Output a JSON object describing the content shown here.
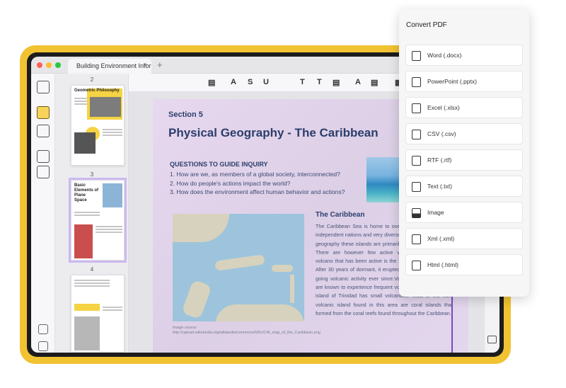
{
  "window": {
    "tab_title": "Building Environment Infor",
    "tab_close": "×",
    "tab_add": "+"
  },
  "thumbnails": [
    {
      "page": "2",
      "title": "Geometric Philosophy"
    },
    {
      "page": "3",
      "title": "Basic Elements of Plane Space"
    },
    {
      "page": "4",
      "title": ""
    }
  ],
  "toolbar": {
    "tools": [
      "▤",
      "A",
      "S",
      "U",
      "T",
      "T",
      "▤",
      "▤",
      "A",
      "▤",
      "▦",
      "◍"
    ],
    "tool_icons": [
      "comment-icon",
      "highlight-icon",
      "strikethrough-icon",
      "underline-icon",
      "text-icon",
      "textbox-icon",
      "note-icon",
      "list-icon",
      "pen-icon",
      "eraser-icon",
      "shape-icon",
      "stamp-icon"
    ]
  },
  "document": {
    "section_label": "Section 5",
    "title": "Physical Geography - The Caribbean",
    "questions_heading": "QUESTIONS TO GUIDE INQUIRY",
    "questions": [
      "1. How are we, as members of a global society, interconnected?",
      "2. How do people's actions impact the world?",
      "3. How does the environment affect human behavior and actions?"
    ],
    "map_caption": "Image source: http://upload.wikimedia.org/wikipedia/commons/0/0c/CIA_map_of_the_Caribbean.png",
    "caribbean_title": "The Caribbean",
    "caribbean_body": "The Caribbean Sea is home to over thirteen of which are independent nations and very diverse in terms of its physical geography these islands are primarily the result of volcanic. There are however few active volcanoes, one known volcano that has been active is the Soufriere of Montserrat. After 30 years of dormant, it erupted in 1995 and has been going volcanic activity ever since.Various of the Caribbean are known to experience frequent volcanic activity, even the island of Trinidad has small volcanoes. Most of the non-volcanic island found in this area are coral islands that formed from the coral reefs found throughout the Caribbean."
  },
  "convert_panel": {
    "title": "Convert PDF",
    "items": [
      {
        "label": "Word (.docx)",
        "icon": "word-icon"
      },
      {
        "label": "PowerPoint (.pptx)",
        "icon": "powerpoint-icon"
      },
      {
        "label": "Excel (.xlsx)",
        "icon": "excel-icon"
      },
      {
        "label": "CSV (.csv)",
        "icon": "csv-icon"
      },
      {
        "label": "RTF (.rtf)",
        "icon": "rtf-icon"
      },
      {
        "label": "Text (.txt)",
        "icon": "text-file-icon"
      },
      {
        "label": "Image",
        "icon": "image-icon"
      },
      {
        "label": "Xml (.xml)",
        "icon": "xml-icon"
      },
      {
        "label": "Html (.html)",
        "icon": "html-icon"
      }
    ]
  },
  "colors": {
    "frame": "#f1c232",
    "accent_purple": "#7a4bc4",
    "title_navy": "#2c3e6b"
  }
}
